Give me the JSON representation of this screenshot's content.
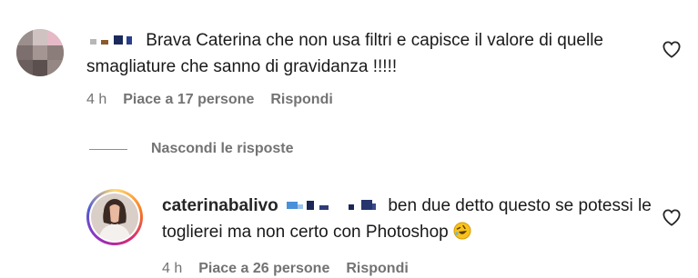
{
  "comments": [
    {
      "text": "Brava Caterina che non usa filtri e capisce il valore di quelle smagliature che sanno di gravidanza !!!!!",
      "time": "4 h",
      "likes": "Piace a 17 persone",
      "reply": "Rispondi"
    }
  ],
  "replies_toggle": {
    "label": "Nascondi le risposte"
  },
  "replies": [
    {
      "username": "caterinabalivo",
      "text": "ben due detto questo se potessi le toglierei ma non certo con Photoshop",
      "time": "4 h",
      "likes": "Piace a 26 persone",
      "reply": "Rispondi"
    }
  ],
  "icons": {
    "like": "heart-icon",
    "emoji": "rolling-on-floor-laughing-emoji"
  },
  "colors": {
    "text": "#262626",
    "secondary": "#737373",
    "story_ring": [
      "#feda75",
      "#fa7e1e",
      "#d62976",
      "#962fbf",
      "#4f5bd5"
    ]
  }
}
